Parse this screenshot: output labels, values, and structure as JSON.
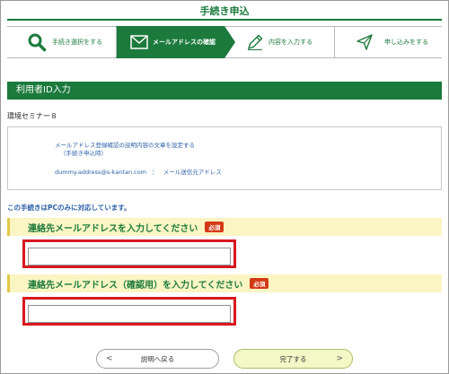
{
  "header": {
    "title": "手続き申込"
  },
  "steps": [
    {
      "label": "手続き選択をする",
      "icon": "search-icon",
      "active": false
    },
    {
      "label": "メールアドレスの確認",
      "icon": "mail-icon",
      "active": true
    },
    {
      "label": "内容を入力する",
      "icon": "pencil-icon",
      "active": false
    },
    {
      "label": "申し込みをする",
      "icon": "send-icon",
      "active": false
    }
  ],
  "section": {
    "title": "利用者ID入力"
  },
  "seminar_name": "環境セミナー８",
  "description": {
    "line1": "メールアドレス登録確認の説明内容の文章を設定する",
    "line2": "（手続き申込時）",
    "sender_address": "dummy.address@s-kantan.com",
    "sender_separator": "：",
    "sender_label": "メール送信元アドレス"
  },
  "pc_notice": "この手続きはPCのみに対応しています。",
  "fields": {
    "email": {
      "label": "連絡先メールアドレスを入力してください",
      "badge": "必須",
      "value": ""
    },
    "email_confirm": {
      "label": "連絡先メールアドレス（確認用）を入力してください",
      "badge": "必須",
      "value": ""
    }
  },
  "buttons": {
    "back": {
      "label": "説明へ戻る",
      "arrow": "<"
    },
    "done": {
      "label": "完了する",
      "arrow": ">"
    }
  },
  "colors": {
    "brand_green": "#1b7a3c",
    "required_red": "#d33a14",
    "highlight_red": "#d71920",
    "field_bg": "#fbf5c4"
  }
}
